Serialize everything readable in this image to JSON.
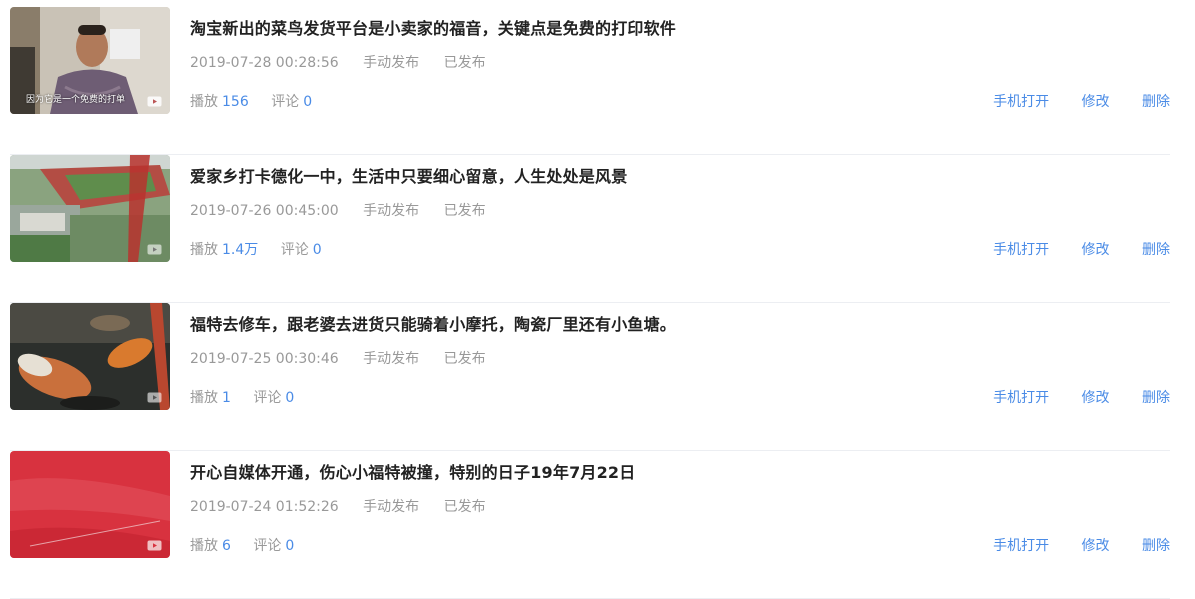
{
  "items": [
    {
      "title": "淘宝新出的菜鸟发货平台是小卖家的福音，关键点是免费的打印软件",
      "date": "2019-07-28 00:28:56",
      "publish_type": "手动发布",
      "status": "已发布",
      "play_label": "播放",
      "play_count": "156",
      "comment_label": "评论",
      "comment_count": "0",
      "thumb_caption": "因为它是一个免费的打单",
      "actions": {
        "mobile": "手机打开",
        "edit": "修改",
        "delete": "删除"
      }
    },
    {
      "title": "爱家乡打卡德化一中，生活中只要细心留意，人生处处是风景",
      "date": "2019-07-26 00:45:00",
      "publish_type": "手动发布",
      "status": "已发布",
      "play_label": "播放",
      "play_count": "1.4万",
      "comment_label": "评论",
      "comment_count": "0",
      "actions": {
        "mobile": "手机打开",
        "edit": "修改",
        "delete": "删除"
      }
    },
    {
      "title": "福特去修车，跟老婆去进货只能骑着小摩托，陶瓷厂里还有小鱼塘。",
      "date": "2019-07-25 00:30:46",
      "publish_type": "手动发布",
      "status": "已发布",
      "play_label": "播放",
      "play_count": "1",
      "comment_label": "评论",
      "comment_count": "0",
      "actions": {
        "mobile": "手机打开",
        "edit": "修改",
        "delete": "删除"
      }
    },
    {
      "title": "开心自媒体开通，伤心小福特被撞，特别的日子19年7月22日",
      "date": "2019-07-24 01:52:26",
      "publish_type": "手动发布",
      "status": "已发布",
      "play_label": "播放",
      "play_count": "6",
      "comment_label": "评论",
      "comment_count": "0",
      "actions": {
        "mobile": "手机打开",
        "edit": "修改",
        "delete": "删除"
      }
    }
  ],
  "colors": {
    "link": "#4a8be6",
    "meta": "#999999",
    "title": "#222222",
    "divider": "#eceef2"
  }
}
